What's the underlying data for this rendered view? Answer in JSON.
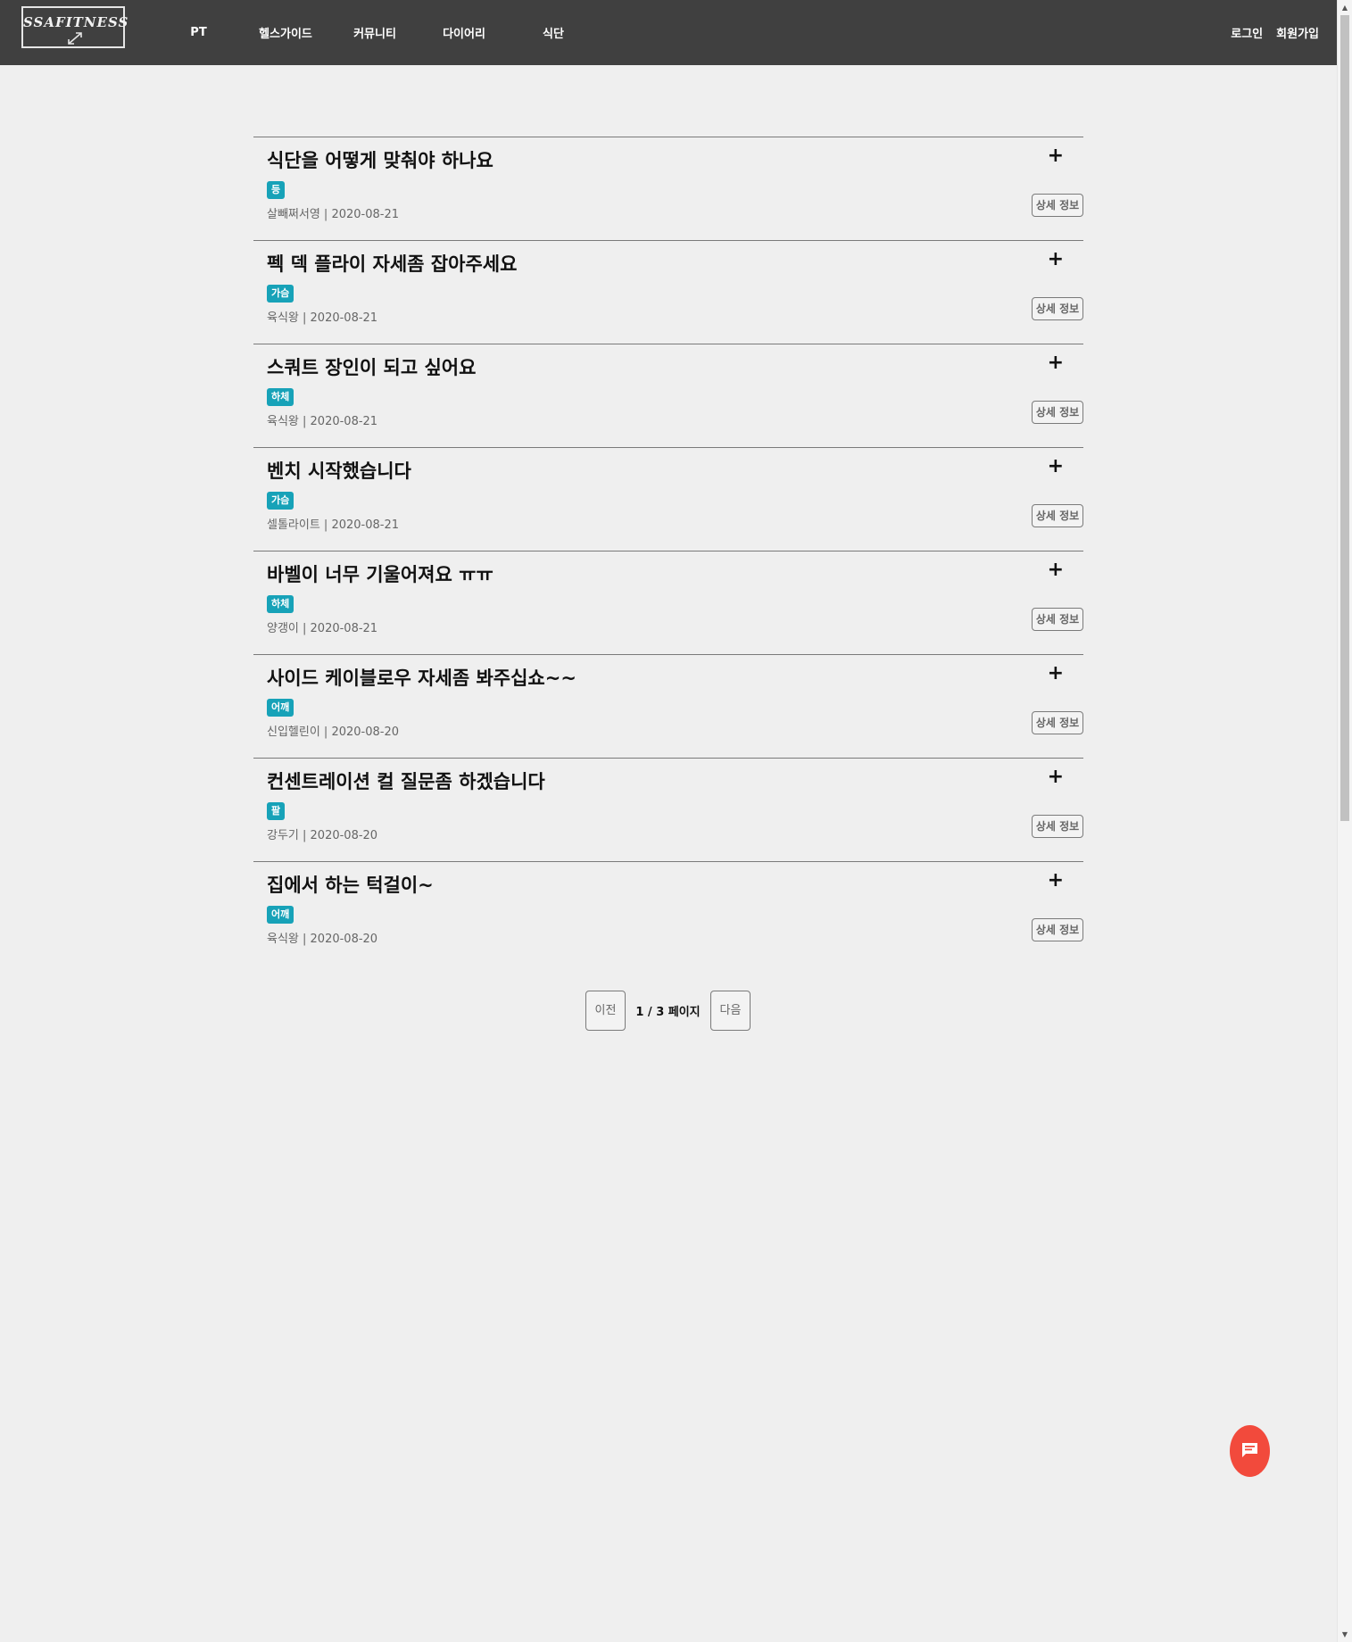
{
  "nav": {
    "logo_text": "SSAFITNESS",
    "links": [
      "PT",
      "헬스가이드",
      "커뮤니티",
      "다이어리",
      "식단"
    ],
    "login": "로그인",
    "signup": "회원가입"
  },
  "posts": [
    {
      "title": "식단을 어떻게 맞춰야 하나요",
      "tag": "등",
      "author": "살빼쩌서영",
      "date": "2020-08-21",
      "meta": "살빼쩌서영 | 2020-08-21",
      "detail_label": "상세 정보"
    },
    {
      "title": "펙 덱 플라이 자세좀 잡아주세요",
      "tag": "가슴",
      "author": "육식왕",
      "date": "2020-08-21",
      "meta": "육식왕 | 2020-08-21",
      "detail_label": "상세 정보"
    },
    {
      "title": "스쿼트 장인이 되고 싶어요",
      "tag": "하체",
      "author": "육식왕",
      "date": "2020-08-21",
      "meta": "육식왕 | 2020-08-21",
      "detail_label": "상세 정보"
    },
    {
      "title": "벤치 시작했습니다",
      "tag": "가슴",
      "author": "셀톨라이트",
      "date": "2020-08-21",
      "meta": "셀톨라이트 | 2020-08-21",
      "detail_label": "상세 정보"
    },
    {
      "title": "바벨이 너무 기울어져요 ㅠㅠ",
      "tag": "하체",
      "author": "양갱이",
      "date": "2020-08-21",
      "meta": "양갱이 | 2020-08-21",
      "detail_label": "상세 정보"
    },
    {
      "title": "사이드 케이블로우 자세좀 봐주십쇼~~",
      "tag": "어깨",
      "author": "신입헬린이",
      "date": "2020-08-20",
      "meta": "신입헬린이 | 2020-08-20",
      "detail_label": "상세 정보"
    },
    {
      "title": "컨센트레이션 컬 질문좀 하겠습니다",
      "tag": "팔",
      "author": "강두기",
      "date": "2020-08-20",
      "meta": "강두기 | 2020-08-20",
      "detail_label": "상세 정보"
    },
    {
      "title": "집에서 하는 턱걸이~",
      "tag": "어깨",
      "author": "육식왕",
      "date": "2020-08-20",
      "meta": "육식왕 | 2020-08-20",
      "detail_label": "상세 정보"
    }
  ],
  "pagination": {
    "prev": "이전",
    "next": "다음",
    "current_page": 1,
    "total_pages": 3,
    "info": "1 / 3 페이지"
  },
  "expand_symbol": "+",
  "colors": {
    "navbar": "#404040",
    "background": "#efefef",
    "tag": "#17a2b8",
    "chat_button": "#f24a3c"
  },
  "icons": {
    "expand": "plus-icon",
    "chat": "chat-icon",
    "logo_arrow": "expand-arrow-icon"
  }
}
